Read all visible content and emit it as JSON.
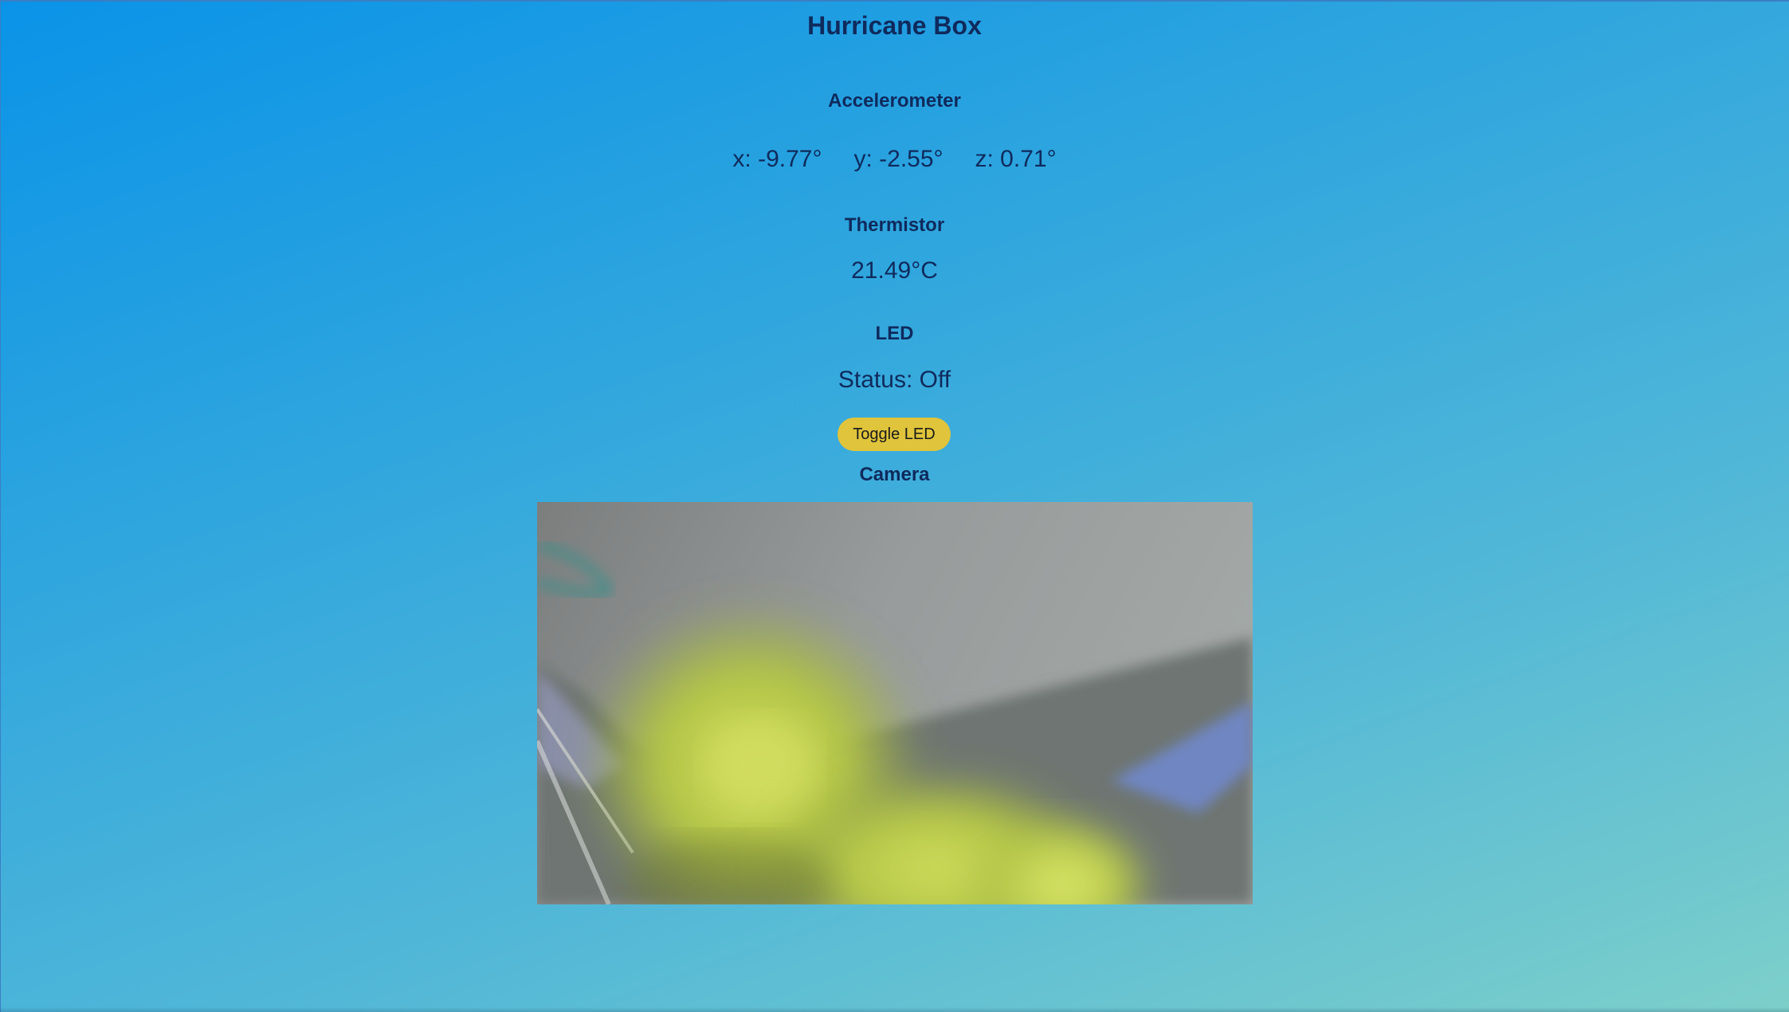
{
  "page": {
    "title": "Hurricane Box"
  },
  "accelerometer": {
    "heading": "Accelerometer",
    "x": "x: -9.77°",
    "y": "y: -2.55°",
    "z": "z: 0.71°"
  },
  "thermistor": {
    "heading": "Thermistor",
    "value": "21.49°C"
  },
  "led": {
    "heading": "LED",
    "status": "Status: Off",
    "toggle_label": "Toggle LED"
  },
  "camera": {
    "heading": "Camera"
  },
  "colors": {
    "background_start": "#0a93e8",
    "background_end": "#7dcfca",
    "text": "#0f2a5c",
    "button": "#dfc43c"
  }
}
